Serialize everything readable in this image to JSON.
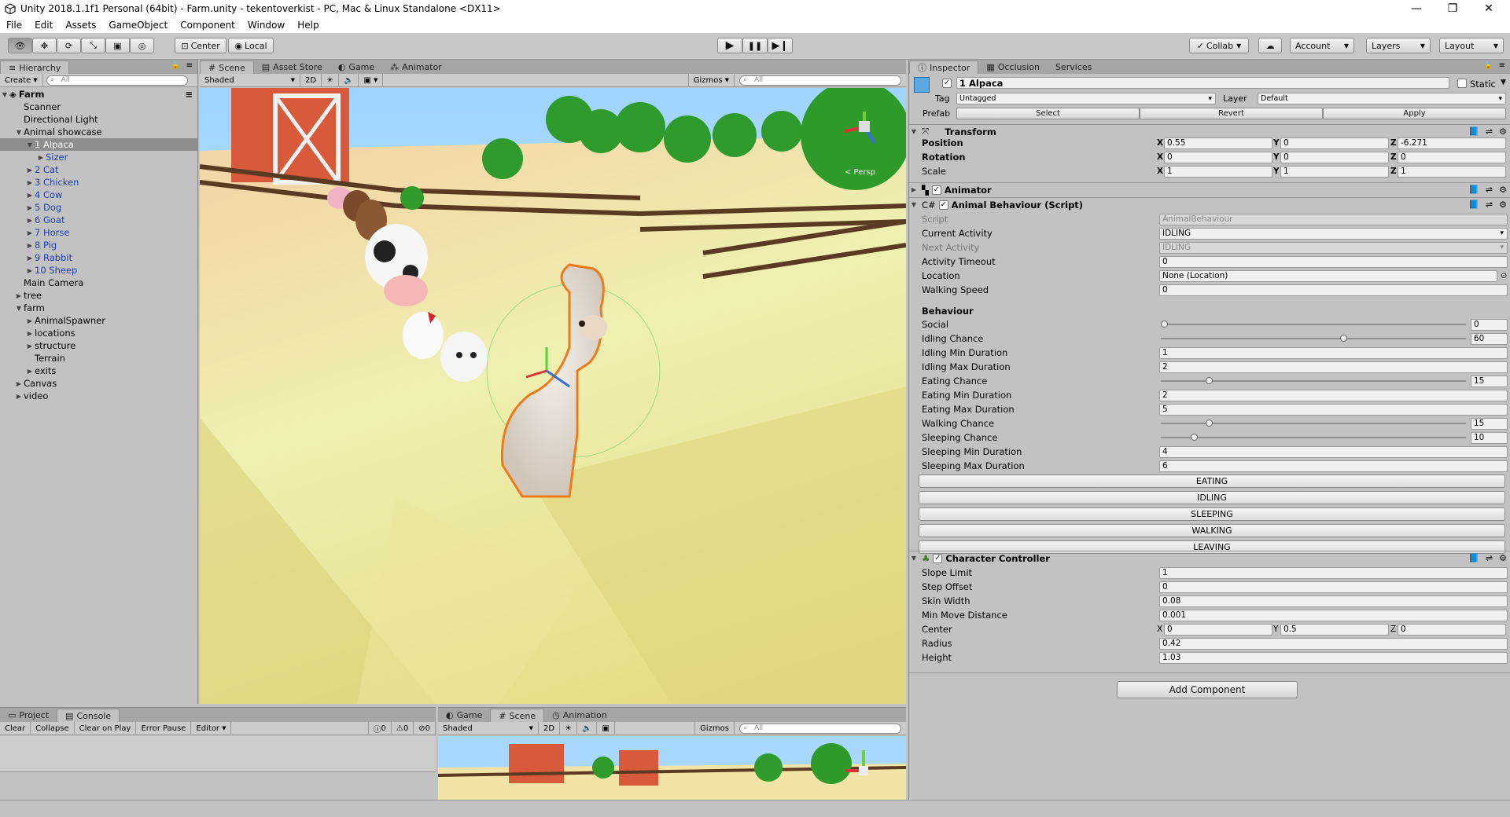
{
  "window": {
    "title": "Unity 2018.1.1f1 Personal (64bit) - Farm.unity - tekentoverkist - PC, Mac & Linux Standalone <DX11>",
    "minimize": "—",
    "maximize": "❐",
    "close": "✕"
  },
  "menu": [
    "File",
    "Edit",
    "Assets",
    "GameObject",
    "Component",
    "Window",
    "Help"
  ],
  "toolbar": {
    "center": "Center",
    "local": "Local",
    "collab": "Collab",
    "account": "Account",
    "layers": "Layers",
    "layout": "Layout"
  },
  "hierarchy": {
    "tab": "Hierarchy",
    "create": "Create",
    "search_placeholder": "All",
    "scene": "Farm",
    "items": [
      {
        "label": "Scanner",
        "indent": 1,
        "arrow": "",
        "sel": false,
        "blue": false
      },
      {
        "label": "Directional Light",
        "indent": 1,
        "arrow": "",
        "sel": false,
        "blue": false
      },
      {
        "label": "Animal showcase",
        "indent": 1,
        "arrow": "▼",
        "sel": false,
        "blue": false
      },
      {
        "label": "1 Alpaca",
        "indent": 2,
        "arrow": "▼",
        "sel": true,
        "blue": true
      },
      {
        "label": "Sizer",
        "indent": 3,
        "arrow": "▶",
        "sel": false,
        "blue": true
      },
      {
        "label": "2 Cat",
        "indent": 2,
        "arrow": "▶",
        "sel": false,
        "blue": true
      },
      {
        "label": "3 Chicken",
        "indent": 2,
        "arrow": "▶",
        "sel": false,
        "blue": true
      },
      {
        "label": "4 Cow",
        "indent": 2,
        "arrow": "▶",
        "sel": false,
        "blue": true
      },
      {
        "label": "5 Dog",
        "indent": 2,
        "arrow": "▶",
        "sel": false,
        "blue": true
      },
      {
        "label": "6 Goat",
        "indent": 2,
        "arrow": "▶",
        "sel": false,
        "blue": true
      },
      {
        "label": "7 Horse",
        "indent": 2,
        "arrow": "▶",
        "sel": false,
        "blue": true
      },
      {
        "label": "8 Pig",
        "indent": 2,
        "arrow": "▶",
        "sel": false,
        "blue": true
      },
      {
        "label": "9 Rabbit",
        "indent": 2,
        "arrow": "▶",
        "sel": false,
        "blue": true
      },
      {
        "label": "10 Sheep",
        "indent": 2,
        "arrow": "▶",
        "sel": false,
        "blue": true
      },
      {
        "label": "Main Camera",
        "indent": 1,
        "arrow": "",
        "sel": false,
        "blue": false
      },
      {
        "label": "tree",
        "indent": 1,
        "arrow": "▶",
        "sel": false,
        "blue": false
      },
      {
        "label": "farm",
        "indent": 1,
        "arrow": "▼",
        "sel": false,
        "blue": false
      },
      {
        "label": "AnimalSpawner",
        "indent": 2,
        "arrow": "▶",
        "sel": false,
        "blue": false
      },
      {
        "label": "locations",
        "indent": 2,
        "arrow": "▶",
        "sel": false,
        "blue": false
      },
      {
        "label": "structure",
        "indent": 2,
        "arrow": "▶",
        "sel": false,
        "blue": false
      },
      {
        "label": "Terrain",
        "indent": 2,
        "arrow": "",
        "sel": false,
        "blue": false
      },
      {
        "label": "exits",
        "indent": 2,
        "arrow": "▶",
        "sel": false,
        "blue": false
      },
      {
        "label": "Canvas",
        "indent": 1,
        "arrow": "▶",
        "sel": false,
        "blue": false
      },
      {
        "label": "video",
        "indent": 1,
        "arrow": "▶",
        "sel": false,
        "blue": false
      }
    ]
  },
  "sceneview": {
    "tabs": [
      "Scene",
      "Asset Store",
      "Game",
      "Animator"
    ],
    "shaded": "Shaded",
    "mode2d": "2D",
    "gizmos": "Gizmos",
    "search_placeholder": "All",
    "persp": "< Persp"
  },
  "inspector": {
    "tabs": [
      "Inspector",
      "Occlusion",
      "Services"
    ],
    "object_name": "1 Alpaca",
    "static": "Static",
    "tag_label": "Tag",
    "tag": "Untagged",
    "layer_label": "Layer",
    "layer": "Default",
    "prefab_label": "Prefab",
    "prefab_buttons": [
      "Select",
      "Revert",
      "Apply"
    ],
    "transform": {
      "title": "Transform",
      "rows": [
        {
          "label": "Position",
          "x": "0.55",
          "y": "0",
          "z": "-6.271"
        },
        {
          "label": "Rotation",
          "x": "0",
          "y": "0",
          "z": "0"
        },
        {
          "label": "Scale",
          "x": "1",
          "y": "1",
          "z": "1"
        }
      ]
    },
    "animator": {
      "title": "Animator"
    },
    "animal_behaviour": {
      "title": "Animal Behaviour (Script)",
      "fields": [
        {
          "label": "Script",
          "value": "AnimalBehaviour",
          "dis": true,
          "dd": false
        },
        {
          "label": "Current Activity",
          "value": "IDLING",
          "dis": false,
          "dd": true
        },
        {
          "label": "Next Activity",
          "value": "IDLING",
          "dis": true,
          "dd": true
        },
        {
          "label": "Activity Timeout",
          "value": "0",
          "dis": false,
          "dd": false
        },
        {
          "label": "Location",
          "value": "None (Location)",
          "dis": false,
          "dd": false
        },
        {
          "label": "Walking Speed",
          "value": "0",
          "dis": false,
          "dd": false
        }
      ],
      "section": "Behaviour",
      "behaviour": [
        {
          "label": "Social",
          "value": "0",
          "slider": 0
        },
        {
          "label": "Idling Chance",
          "value": "60",
          "slider": 0.6
        },
        {
          "label": "Idling Min Duration",
          "value": "1",
          "slider": null
        },
        {
          "label": "Idling Max Duration",
          "value": "2",
          "slider": null
        },
        {
          "label": "Eating Chance",
          "value": "15",
          "slider": 0.15
        },
        {
          "label": "Eating Min Duration",
          "value": "2",
          "slider": null
        },
        {
          "label": "Eating Max Duration",
          "value": "5",
          "slider": null
        },
        {
          "label": "Walking Chance",
          "value": "15",
          "slider": 0.15
        },
        {
          "label": "Sleeping Chance",
          "value": "10",
          "slider": 0.1
        },
        {
          "label": "Sleeping Min Duration",
          "value": "4",
          "slider": null
        },
        {
          "label": "Sleeping Max Duration",
          "value": "6",
          "slider": null
        }
      ],
      "buttons": [
        "EATING",
        "IDLING",
        "SLEEPING",
        "WALKING",
        "LEAVING"
      ]
    },
    "character_controller": {
      "title": "Character Controller",
      "rows": [
        {
          "label": "Slope Limit",
          "value": "1"
        },
        {
          "label": "Step Offset",
          "value": "0"
        },
        {
          "label": "Skin Width",
          "value": "0.08"
        },
        {
          "label": "Min Move Distance",
          "value": "0.001"
        }
      ],
      "center": {
        "label": "Center",
        "x": "0",
        "y": "0.5",
        "z": "0"
      },
      "rows2": [
        {
          "label": "Radius",
          "value": "0.42"
        },
        {
          "label": "Height",
          "value": "1.03"
        }
      ]
    },
    "add_component": "Add Component"
  },
  "console": {
    "tabs": [
      "Project",
      "Console"
    ],
    "buttons": [
      "Clear",
      "Collapse",
      "Clear on Play",
      "Error Pause",
      "Editor"
    ],
    "counts": [
      "0",
      "0",
      "0"
    ]
  },
  "bottomscene": {
    "tabs": [
      "Game",
      "Scene",
      "Animation"
    ],
    "shaded": "Shaded",
    "mode2d": "2D",
    "gizmos": "Gizmos",
    "search_placeholder": "All"
  }
}
